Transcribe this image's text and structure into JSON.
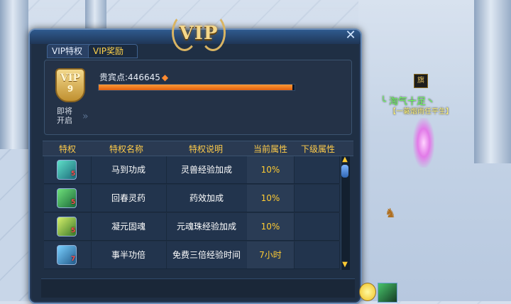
{
  "window": {
    "emblem": "VIP"
  },
  "tabs": [
    {
      "label": "VIP特权"
    },
    {
      "label": "VIP奖励"
    }
  ],
  "vip": {
    "badge_label": "VIP",
    "level": "9",
    "points_label": "贵宾点:",
    "points_value": "446645",
    "progress_fraction": 0.99,
    "coming_soon": "即将开启"
  },
  "table": {
    "headers": [
      "特权",
      "特权名称",
      "特权说明",
      "当前属性",
      "下级属性"
    ],
    "rows": [
      {
        "icon": "horse-skill-icon",
        "level": "5",
        "name": "马到功成",
        "desc": "灵兽经验加成",
        "current": "10%",
        "next": ""
      },
      {
        "icon": "herb-skill-icon",
        "level": "5",
        "name": "回春灵药",
        "desc": "药效加成",
        "current": "10%",
        "next": ""
      },
      {
        "icon": "soul-orb-skill-icon",
        "level": "5",
        "name": "凝元固魂",
        "desc": "元魂珠经验加成",
        "current": "10%",
        "next": ""
      },
      {
        "icon": "double-exp-skill-icon",
        "level": "7",
        "name": "事半功倍",
        "desc": "免费三倍经验时间",
        "current": "7小时",
        "next": ""
      }
    ]
  },
  "character": {
    "name": "╰ 淘气十足丶",
    "title": "【一蓑烟雨任平生】"
  },
  "colors": {
    "header_text": "#ffcc4a",
    "value_text": "#ffcc33",
    "progress": "#e06010",
    "name_green": "#6dff5a"
  }
}
